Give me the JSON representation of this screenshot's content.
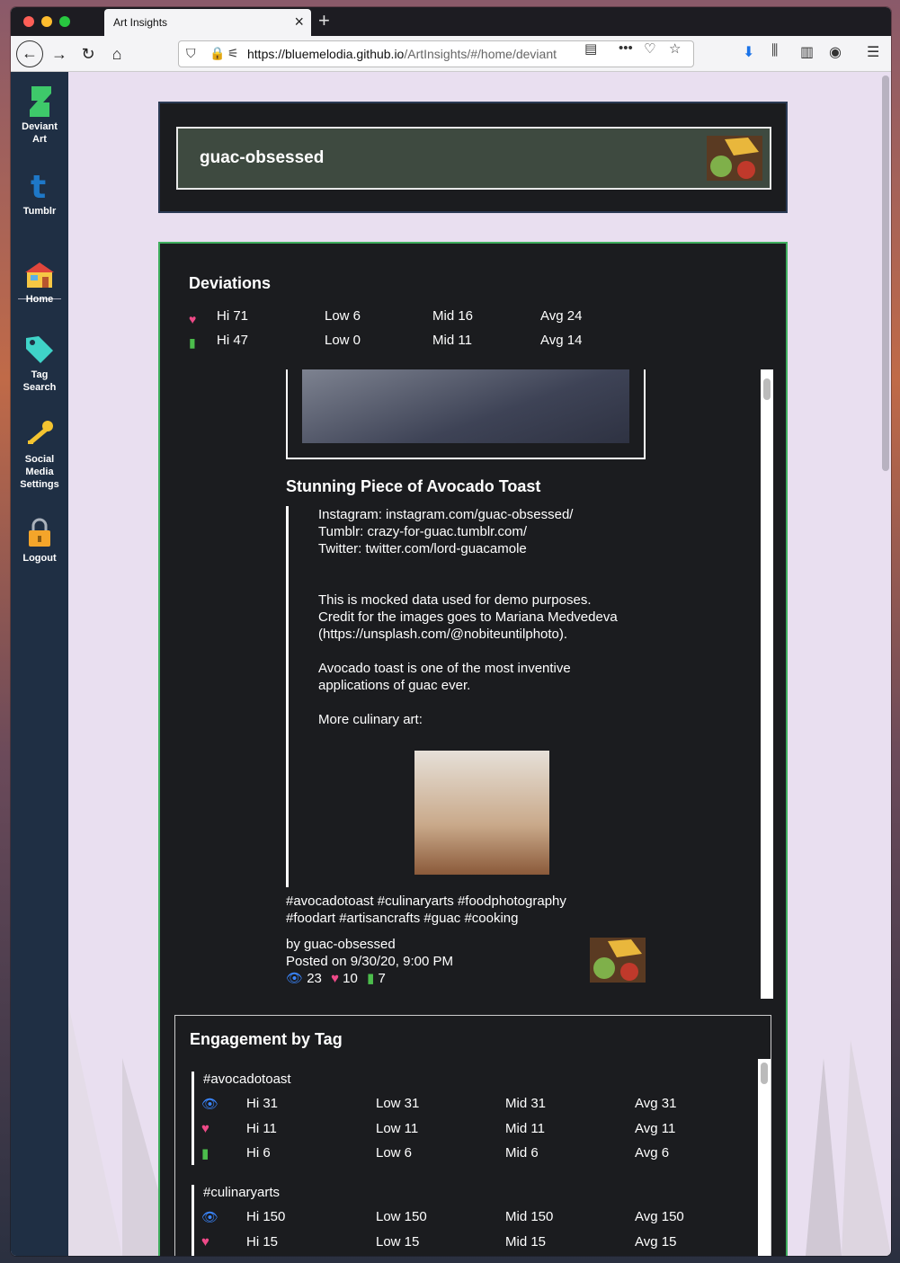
{
  "browser": {
    "tab_title": "Art Insights",
    "url_host": "https://bluemelodia.github.io",
    "url_path": "/ArtInsights/#/home/deviant"
  },
  "sidebar": {
    "items": [
      {
        "label_lines": [
          "Deviant",
          "Art"
        ],
        "icon": "deviantart-icon"
      },
      {
        "label_lines": [
          "Tumblr"
        ],
        "icon": "tumblr-icon"
      },
      {
        "label_lines": [
          "Home"
        ],
        "icon": "home-icon"
      },
      {
        "label_lines": [
          "Tag",
          "Search"
        ],
        "icon": "tag-icon"
      },
      {
        "label_lines": [
          "Social",
          "Media",
          "Settings"
        ],
        "icon": "key-icon"
      },
      {
        "label_lines": [
          "Logout"
        ],
        "icon": "lock-icon"
      }
    ]
  },
  "profile": {
    "username": "guac-obsessed"
  },
  "deviations": {
    "title": "Deviations",
    "favorites": {
      "hi": "Hi 71",
      "low": "Low 6",
      "mid": "Mid 16",
      "avg": "Avg 24"
    },
    "comments": {
      "hi": "Hi 47",
      "low": "Low 0",
      "mid": "Mid 11",
      "avg": "Avg 14"
    }
  },
  "deviation": {
    "title": "Stunning Piece of Avocado Toast",
    "links": [
      "Instagram: instagram.com/guac-obsessed/",
      "Tumblr: crazy-for-guac.tumblr.com/",
      "Twitter: twitter.com/lord-guacamole"
    ],
    "para1": [
      "This is mocked data used for demo purposes.",
      "Credit for the images goes to Mariana Medvedeva",
      "(https://unsplash.com/@nobiteuntilphoto)."
    ],
    "para2": [
      "Avocado toast is one of the most inventive",
      "applications of guac ever."
    ],
    "para3": "More culinary art:",
    "tags_line1": "#avocadotoast #culinaryarts #foodphotography",
    "tags_line2": "#foodart #artisancrafts #guac #cooking",
    "author": "by guac-obsessed",
    "posted": "Posted on 9/30/20, 9:00 PM",
    "views": "23",
    "favorites": "10",
    "comments": "7"
  },
  "engagement": {
    "title": "Engagement by Tag",
    "tags": [
      {
        "name": "#avocadotoast",
        "views": {
          "hi": "Hi 31",
          "low": "Low 31",
          "mid": "Mid 31",
          "avg": "Avg 31"
        },
        "favorites": {
          "hi": "Hi 11",
          "low": "Low 11",
          "mid": "Mid 11",
          "avg": "Avg 11"
        },
        "comments": {
          "hi": "Hi 6",
          "low": "Low 6",
          "mid": "Mid 6",
          "avg": "Avg 6"
        }
      },
      {
        "name": "#culinaryarts",
        "views": {
          "hi": "Hi 150",
          "low": "Low 150",
          "mid": "Mid 150",
          "avg": "Avg 150"
        },
        "favorites": {
          "hi": "Hi 15",
          "low": "Low 15",
          "mid": "Mid 15",
          "avg": "Avg 15"
        }
      }
    ]
  },
  "colors": {
    "sidebar": "#1f2f44",
    "card_border": "#3fae5e",
    "heart": "#ee4a88",
    "comment": "#4cbd4c",
    "eye": "#3a86ff"
  }
}
